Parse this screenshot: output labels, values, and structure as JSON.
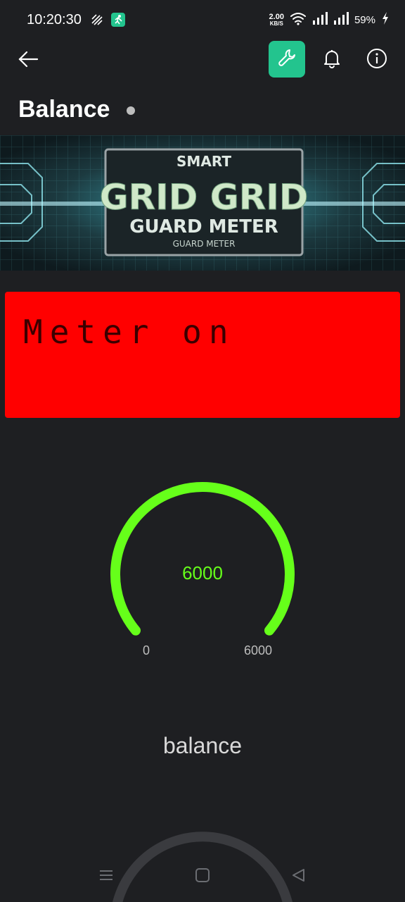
{
  "status_bar": {
    "time": "10:20:30",
    "net_speed_value": "2.00",
    "net_speed_unit": "KB/S",
    "battery": "59%",
    "icons": [
      "data-saver-icon",
      "running-app-icon",
      "wifi-icon",
      "signal-icon",
      "signal-icon",
      "charging-bolt-icon"
    ]
  },
  "top_bar": {
    "back_icon": "arrow-left-icon",
    "wrench_icon": "wrench-icon",
    "bell_icon": "bell-icon",
    "info_icon": "info-icon",
    "accent": "#23c48e"
  },
  "page": {
    "title": "Balance"
  },
  "banner": {
    "line1": "SMART",
    "line2": "GRID GRID",
    "line3": "GUARD METER",
    "line4": "GUARD METER"
  },
  "lcd": {
    "text": "Meter on",
    "background": "#ff0000"
  },
  "gauge": {
    "value": "6000",
    "min": "0",
    "max": "6000",
    "fill_fraction": 1.0,
    "color": "#66ff1a",
    "label": "balance"
  },
  "nav_bar": {
    "recents_icon": "menu-lines-icon",
    "home_icon": "square-home-icon",
    "back_icon": "triangle-back-icon"
  }
}
